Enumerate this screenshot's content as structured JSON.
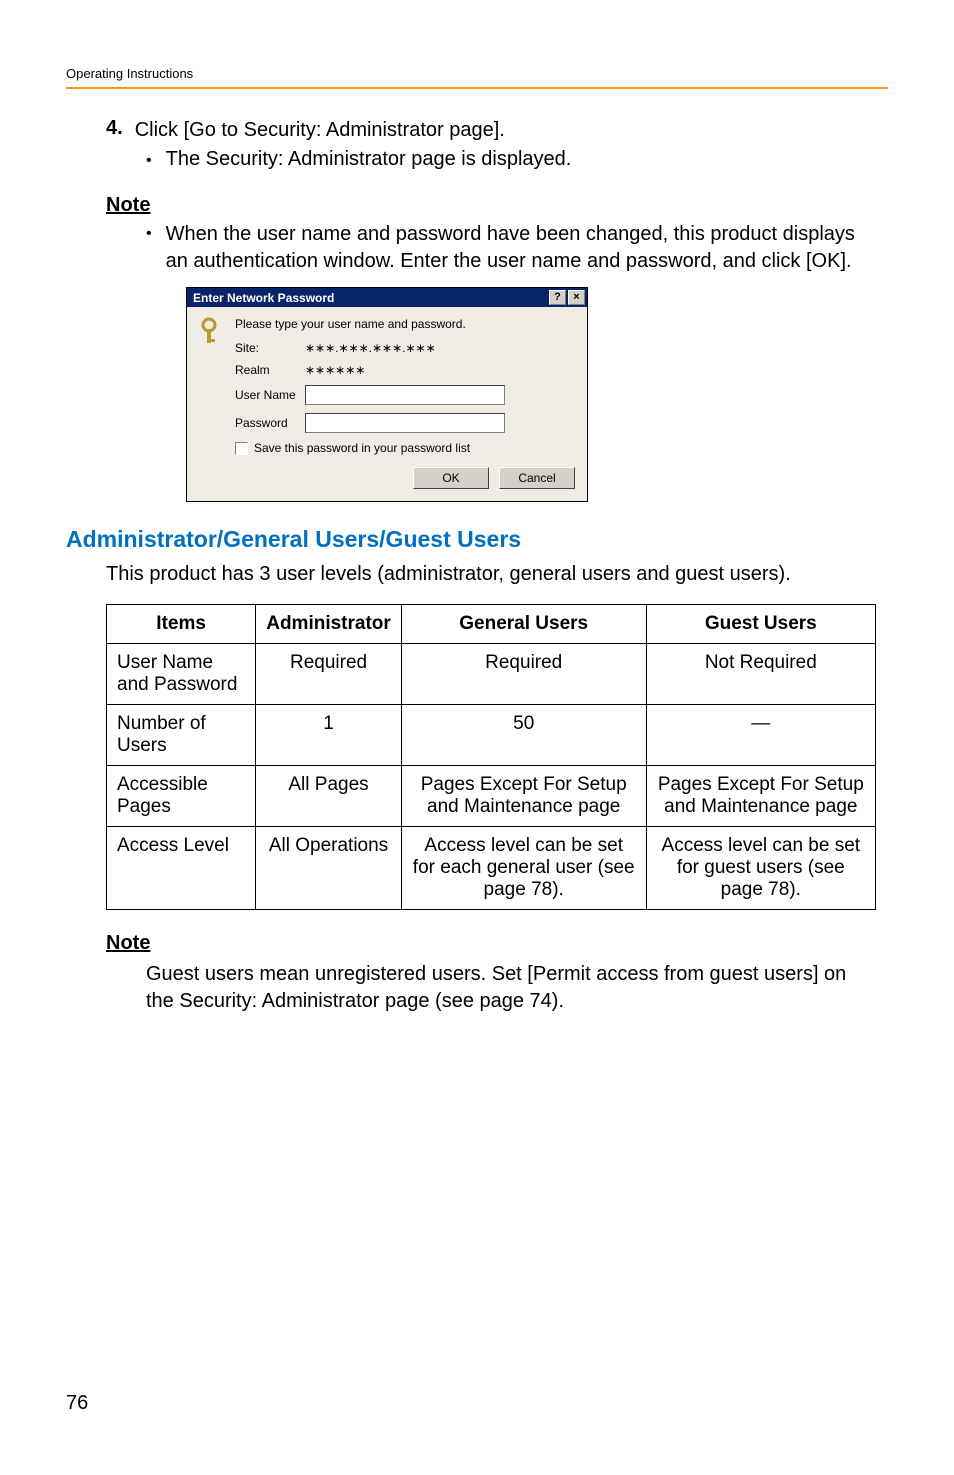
{
  "header": {
    "running": "Operating Instructions"
  },
  "step": {
    "num": "4.",
    "text": "Click [Go to Security: Administrator page].",
    "sub": "The Security: Administrator page is displayed."
  },
  "note1": {
    "heading": "Note",
    "text": "When the user name and password have been changed, this product displays an authentication window. Enter the user name and password, and click [OK]."
  },
  "dialog": {
    "title": "Enter Network Password",
    "help": "?",
    "close": "×",
    "instr": "Please type your user name and password.",
    "labels": {
      "site": "Site:",
      "realm": "Realm",
      "user": "User Name",
      "pass": "Password"
    },
    "values": {
      "site": "∗∗∗.∗∗∗.∗∗∗.∗∗∗",
      "realm": "∗∗∗∗∗∗"
    },
    "save_chk": "Save this password in your password list",
    "ok": "OK",
    "cancel": "Cancel"
  },
  "section": {
    "heading": "Administrator/General Users/Guest Users",
    "intro": "This product has 3 user levels (administrator, general users and guest users)."
  },
  "chart_data": {
    "type": "table",
    "headers": [
      "Items",
      "Administrator",
      "General Users",
      "Guest Users"
    ],
    "rows": [
      [
        "User Name and Password",
        "Required",
        "Required",
        "Not Required"
      ],
      [
        "Number of Users",
        "1",
        "50",
        "—"
      ],
      [
        "Accessible Pages",
        "All Pages",
        "Pages Except For Setup and Maintenance page",
        "Pages Except For Setup and Maintenance page"
      ],
      [
        "Access Level",
        "All Operations",
        "Access level can be set for each general user (see page 78).",
        "Access level can be set for guest users (see page 78)."
      ]
    ]
  },
  "note2": {
    "heading": "Note",
    "text": "Guest users mean unregistered users. Set [Permit access from guest users] on the Security: Administrator page (see page 74)."
  },
  "page": {
    "number": "76"
  }
}
